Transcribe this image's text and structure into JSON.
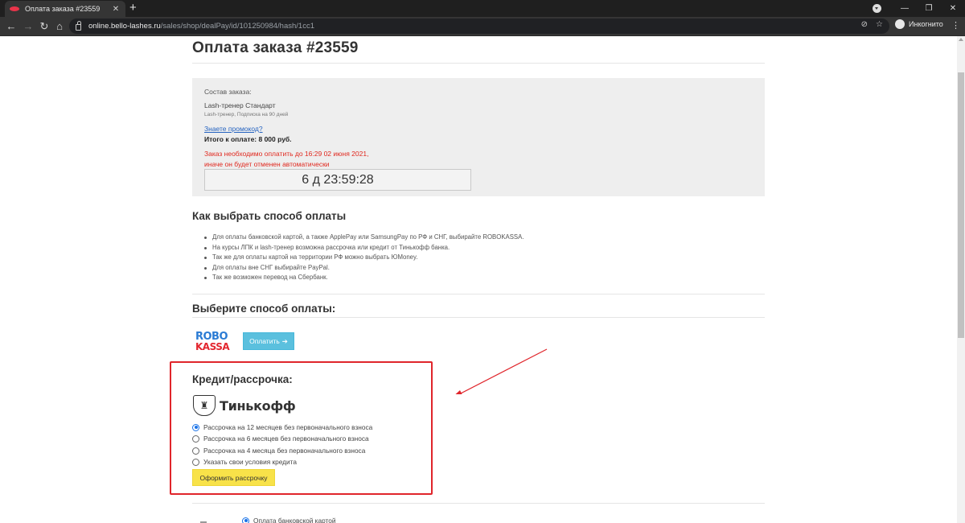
{
  "browser": {
    "tab_title": "Оплата заказа #23559",
    "tab_close": "✕",
    "new_tab": "+",
    "url_host": "online.bello-lashes.ru",
    "url_path": "/sales/shop/dealPay/id/101250984/hash/1cc1",
    "profile_label": "Инкогнито",
    "icons": [
      "back-icon",
      "forward-icon",
      "reload-icon",
      "home-icon",
      "lock-icon",
      "eye-off-icon",
      "star-icon",
      "incognito-icon",
      "menu-icon"
    ]
  },
  "page": {
    "title": "Оплата заказа #23559"
  },
  "order": {
    "composition_label": "Состав заказа:",
    "product_name": "Lash-тренер Стандарт",
    "product_desc": "Lash-тренер, Подписка на 90 дней",
    "promo_link": "Знаете промокод?",
    "total": "Итого к оплате: 8 000 руб.",
    "deadline_line1": "Заказ необходимо оплатить до 16:29 02 июня 2021,",
    "deadline_line2": "иначе он будет отменен автоматически",
    "timer": "6 д 23:59:28"
  },
  "howto": {
    "heading": "Как выбрать способ оплаты",
    "items": [
      "Для оплаты банковской картой, а также ApplePay или SamsungPay по РФ и СНГ, выбирайте ROBOKASSA.",
      "На курсы ЛПК и lash-тренер возможна рассрочка или кредит от Тинькофф банка.",
      "Так же для оплаты картой на территории РФ можно выбрать ЮMoney.",
      "Для оплаты вне СНГ выбирайте PayPal.",
      "Так же возможен перевод на Сбербанк."
    ]
  },
  "payment": {
    "heading": "Выберите способ оплаты:",
    "robokassa_top": "ROBO",
    "robokassa_bottom": "KASSA",
    "pay_button": "Оплатить",
    "pay_arrow": "➔"
  },
  "credit": {
    "heading": "Кредит/рассрочка:",
    "bank_name": "Тинькофф",
    "options": [
      {
        "label": "Рассрочка на 12 месяцев без первоначального взноса",
        "checked": true
      },
      {
        "label": "Рассрочка на 6 месяцев без первоначального взноса",
        "checked": false
      },
      {
        "label": "Рассрочка на 4 месяца без первоначального взноса",
        "checked": false
      },
      {
        "label": "Указать свои условия кредита",
        "checked": false
      }
    ],
    "submit_button": "Оформить рассрочку"
  },
  "bottom": {
    "card_option": "Оплата банковской картой"
  },
  "colors": {
    "highlight_box": "#e0252b",
    "pay_button": "#5bc0de",
    "credit_button": "#f8e249",
    "warning_text": "#e0281e",
    "link": "#2563c0"
  }
}
